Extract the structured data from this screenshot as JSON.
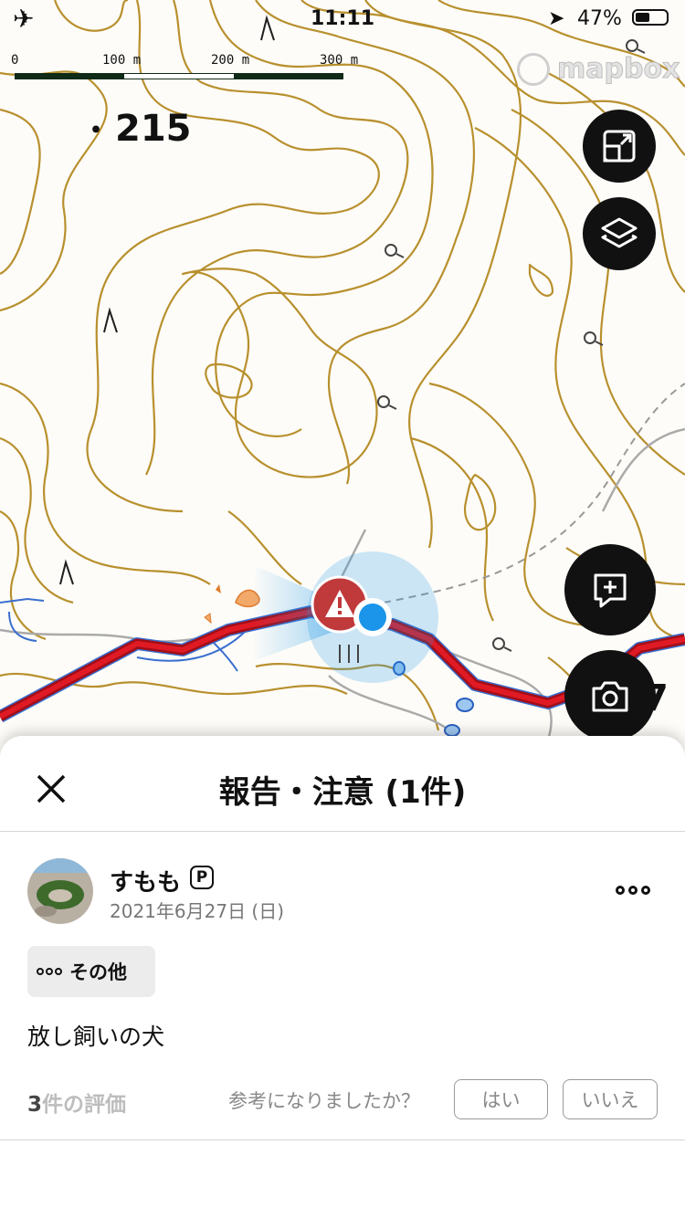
{
  "status_bar": {
    "time": "11:11",
    "battery": "47%",
    "battery_level": 0.47
  },
  "map": {
    "scale_labels": [
      "0",
      "100 m",
      "200 m",
      "300 m"
    ],
    "attribution": "mapbox",
    "elevation_label": "215",
    "edge_label": "7",
    "colors": {
      "contour": "#b8902e",
      "route": "#d0121b",
      "river": "#3a6fd0",
      "location": "#1a95ea"
    },
    "buttons": {
      "fit": "fit-bounds-icon",
      "layers": "layers-icon",
      "add_report": "add-report-icon",
      "camera": "camera-icon"
    }
  },
  "sheet": {
    "title": "報告・注意 (1件)",
    "report": {
      "user_name": "すもも",
      "premium_badge": "P",
      "date": "2021年6月27日 (日)",
      "category": "その他",
      "text": "放し飼いの犬",
      "rating_count": "3",
      "rating_suffix": "件の評価",
      "helpful_question": "参考になりましたか？",
      "yes": "はい",
      "no": "いいえ"
    }
  }
}
